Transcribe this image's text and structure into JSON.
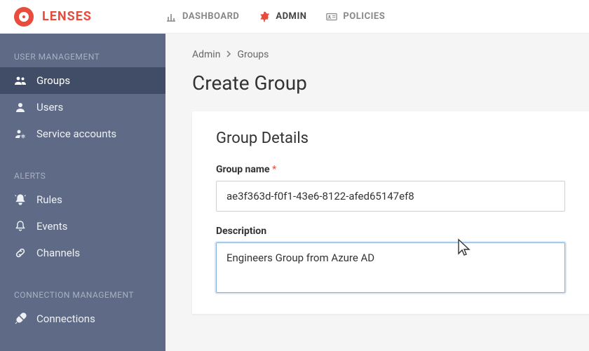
{
  "brand": "LENSES",
  "topnav": {
    "dashboard": "DASHBOARD",
    "admin": "ADMIN",
    "policies": "POLICIES"
  },
  "sidebar": {
    "heading_user": "USER MANAGEMENT",
    "groups": "Groups",
    "users": "Users",
    "service_accounts": "Service accounts",
    "heading_alerts": "ALERTS",
    "rules": "Rules",
    "events": "Events",
    "channels": "Channels",
    "heading_conn": "CONNECTION MANAGEMENT",
    "connections": "Connections"
  },
  "breadcrumb": {
    "admin": "Admin",
    "groups": "Groups"
  },
  "page_title": "Create Group",
  "card": {
    "title": "Group Details",
    "group_name_label": "Group name",
    "group_name_value": "ae3f363d-f0f1-43e6-8122-afed65147ef8",
    "description_label": "Description",
    "description_value": "Engineers Group from Azure AD"
  }
}
